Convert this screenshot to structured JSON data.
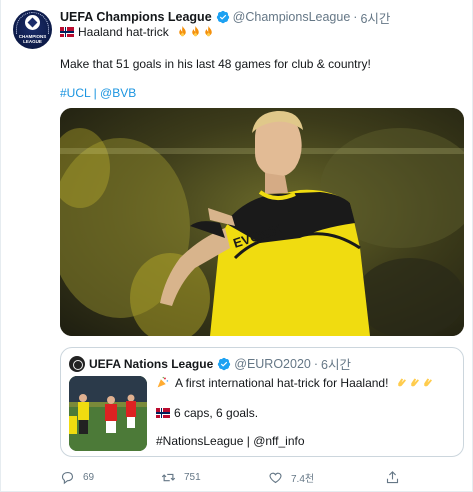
{
  "tweet": {
    "author": {
      "name": "UEFA Champions League",
      "handle": "@ChampionsLeague",
      "time": "6시간",
      "avatar_text": "CHAMPIONS LEAGUE"
    },
    "title_line": "Haaland hat-trick",
    "body": "Make that 51 goals in his last 48 games for club & country!",
    "hashtags": {
      "tag1": "#UCL",
      "separator": "|",
      "tag2": "@BVB"
    },
    "photo": {
      "icon": "football-player-photo",
      "shirt_text": "EVONIK"
    }
  },
  "quoted": {
    "author": {
      "name": "UEFA Nations League",
      "handle": "@EURO2020",
      "time": "6시간"
    },
    "line1": "A first international hat-trick for Haaland!",
    "line2": "6 caps, 6 goals.",
    "line3": "#NationsLeague | @nff_info"
  },
  "actions": {
    "reply_count": "69",
    "retweet_count": "751",
    "like_count": "7.4천"
  },
  "colors": {
    "link": "#1b95e0",
    "muted": "#657786",
    "verified": "#1da1f2",
    "border": "#ccd6dd"
  }
}
